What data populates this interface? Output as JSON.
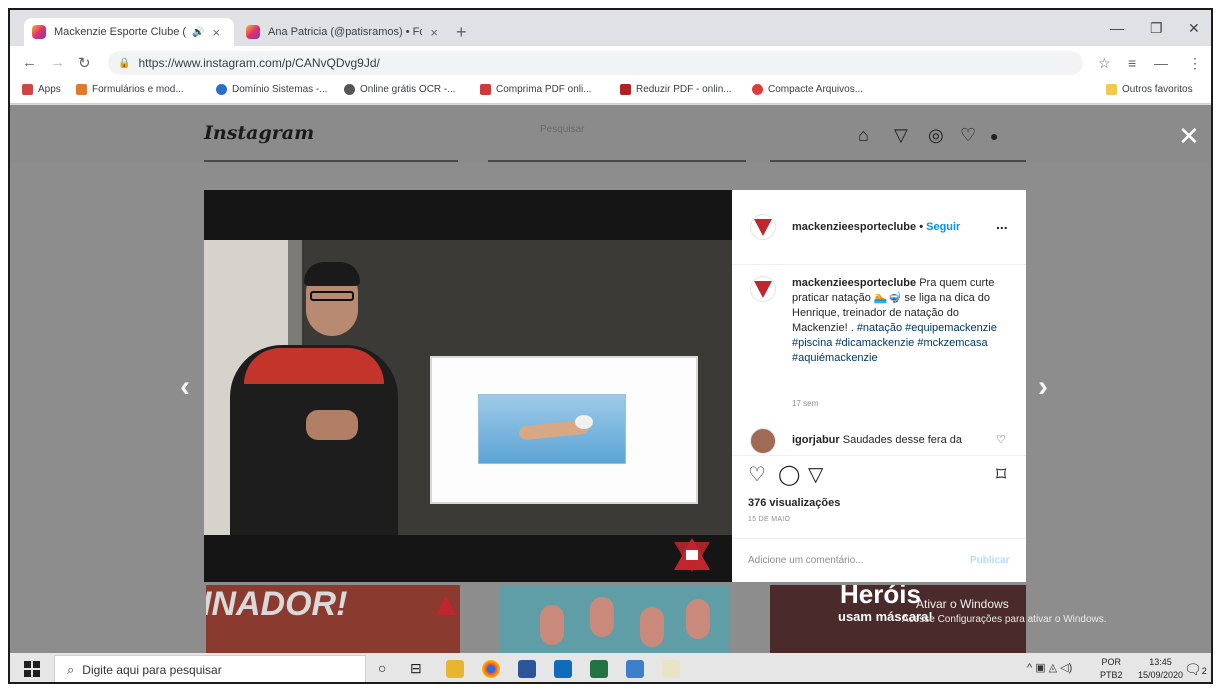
{
  "browser": {
    "tabs": [
      {
        "title": "Mackenzie Esporte Clube (",
        "active": true
      },
      {
        "title": "Ana Patricia (@patisramos) • Fot",
        "active": false
      }
    ],
    "new_tab": "+",
    "url": "https://www.instagram.com/p/CANvQDvg9Jd/",
    "bookmarks": [
      {
        "label": "Apps",
        "color": "#d04545"
      },
      {
        "label": "Formulários e mod...",
        "color": "#e07b2e"
      },
      {
        "label": "Domínio Sistemas -...",
        "color": "#2a6fc7"
      },
      {
        "label": "Online grátis OCR -...",
        "color": "#555555"
      },
      {
        "label": "Comprima PDF onli...",
        "color": "#d03a3a"
      },
      {
        "label": "Reduzir PDF - onlin...",
        "color": "#b22222"
      },
      {
        "label": "Compacte Arquivos...",
        "color": "#e03a3a"
      }
    ],
    "other_bookmarks": "Outros favoritos"
  },
  "instagram": {
    "logo": "Instagram",
    "search_placeholder": "Pesquisar",
    "post": {
      "username": "mackenzieesporteclube",
      "follow": "Seguir",
      "more": "...",
      "caption_user": "mackenzieesporteclube",
      "caption_text": "Pra quem curte praticar natação 🏊🤿 se liga na dica do Henrique, treinador de natação do Mackenzie! .",
      "caption_tags": "#natação #equipemackenzie #piscina #dicamackenzie #mckzemcasa #aquiémackenzie",
      "caption_time": "17 sem",
      "comment_user": "igorjabur",
      "comment_text": "Saudades desse fera da",
      "views": "376 visualizações",
      "date": "15 DE MAIO",
      "add_comment_placeholder": "Adicione um comentário...",
      "publish": "Publicar"
    },
    "grid": {
      "thumb1_text": "INADOR!",
      "thumb3_text1": "Heróis",
      "thumb3_text2": "usam máscara!"
    },
    "watermark_title": "Ativar o Windows",
    "watermark_sub": "Acesse Configurações para ativar o Windows."
  },
  "taskbar": {
    "search_placeholder": "Digite aqui para pesquisar",
    "lang1": "POR",
    "lang2": "PTB2",
    "time": "13:45",
    "date": "15/09/2020",
    "notifications": "2"
  },
  "colors": {
    "accent_blue": "#0095f6",
    "mackenzie_red": "#c0262d"
  }
}
